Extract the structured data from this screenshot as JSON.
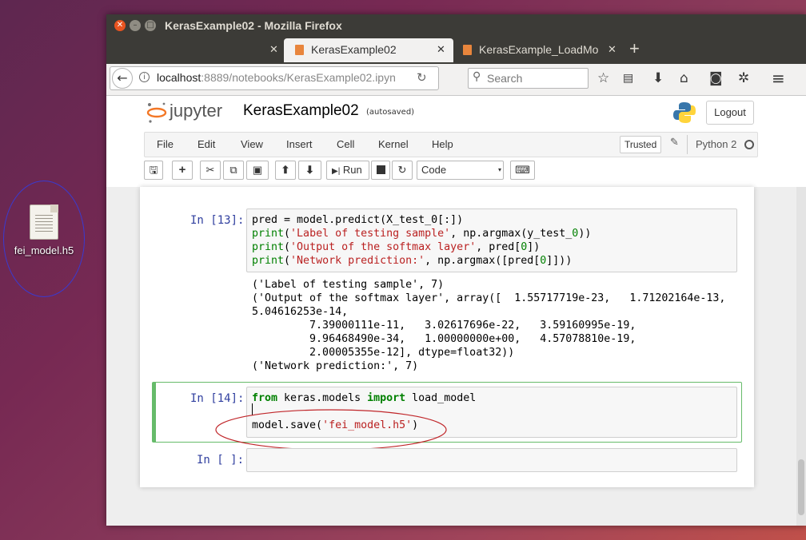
{
  "desktop": {
    "file_label": "fei_model.h5"
  },
  "window": {
    "title": "KerasExample02 - Mozilla Firefox"
  },
  "tabs": [
    {
      "label": "KerasExample02"
    },
    {
      "label": "KerasExample_LoadMo"
    }
  ],
  "nav": {
    "url_host": "localhost",
    "url_rest": ":8889/notebooks/KerasExample02.ipyn",
    "search_placeholder": "Search"
  },
  "jupyter": {
    "logo_text": "jupyter",
    "notebook_name": "KerasExample02",
    "save_status": "(autosaved)",
    "logout_label": "Logout",
    "menu": [
      "File",
      "Edit",
      "View",
      "Insert",
      "Cell",
      "Kernel",
      "Help"
    ],
    "trusted_label": "Trusted",
    "kernel_name": "Python 2",
    "run_label": "Run",
    "cell_type": "Code"
  },
  "cells": [
    {
      "prompt": "In [13]:",
      "output": [
        "('Label of testing sample', 7)",
        "('Output of the softmax layer', array([  1.55717719e-23,   1.71202164e-13,",
        "5.04616253e-14,",
        "         7.39000111e-11,   3.02617696e-22,   3.59160995e-19,",
        "         9.96468490e-34,   1.00000000e+00,   4.57078810e-19,",
        "         2.00005355e-12], dtype=float32))",
        "('Network prediction:', 7)"
      ]
    },
    {
      "prompt": "In [14]:"
    },
    {
      "prompt": "In [ ]:"
    }
  ],
  "colors": {
    "prompt": "#303f9f",
    "string": "#ba2121",
    "keyword": "#008000",
    "selected_cell": "#66bb6a",
    "annotation_ellipse": "#c0262a"
  }
}
